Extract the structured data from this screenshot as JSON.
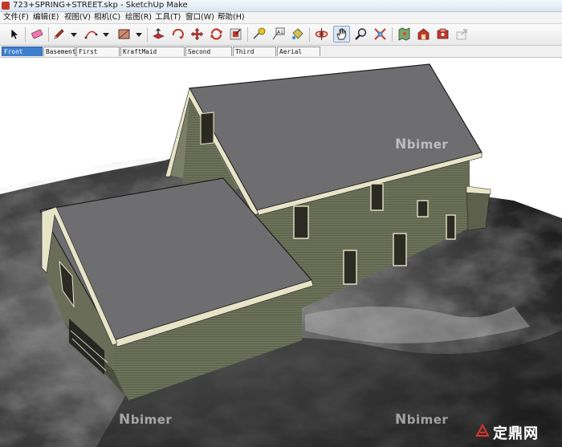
{
  "window": {
    "title": "723+SPRING+STREET.skp - SketchUp Make"
  },
  "menu": [
    {
      "id": "file",
      "label": "文件(F)"
    },
    {
      "id": "edit",
      "label": "编辑(E)"
    },
    {
      "id": "view",
      "label": "视图(V)"
    },
    {
      "id": "camera",
      "label": "相机(C)"
    },
    {
      "id": "draw",
      "label": "绘图(R)"
    },
    {
      "id": "tools",
      "label": "工具(T)"
    },
    {
      "id": "window",
      "label": "窗口(W)"
    },
    {
      "id": "help",
      "label": "帮助(H)"
    }
  ],
  "toolbar": {
    "tools": [
      "select-icon",
      "eraser-icon",
      "pencil-icon",
      "arc-icon",
      "rectangle-icon",
      "push-pull-icon",
      "rotate-icon",
      "move-icon",
      "follow-me-icon",
      "offset-icon",
      "tape-measure-icon",
      "text-icon",
      "paint-bucket-icon",
      "orbit-icon",
      "pan-icon",
      "zoom-icon",
      "zoom-extents-icon",
      "map-icon",
      "warehouse-icon",
      "extension-warehouse-icon",
      "share-icon"
    ],
    "pressed": "pan-icon"
  },
  "scenes": [
    {
      "label": "Front View",
      "active": true
    },
    {
      "label": "Basement",
      "active": false
    },
    {
      "label": "First Floor",
      "active": false
    },
    {
      "label": "KraftMaid Kitchen",
      "active": false
    },
    {
      "label": "Second Floor",
      "active": false
    },
    {
      "label": "Third Floor",
      "active": false
    },
    {
      "label": "Aerial View",
      "active": false
    }
  ],
  "watermarks": {
    "text": "bimer",
    "brand": "定鼎网"
  },
  "colors": {
    "roof": "#6e6e70",
    "wall": "#6b7058",
    "trim": "#e8e4c8",
    "active_tab": "#3f7fd0"
  }
}
